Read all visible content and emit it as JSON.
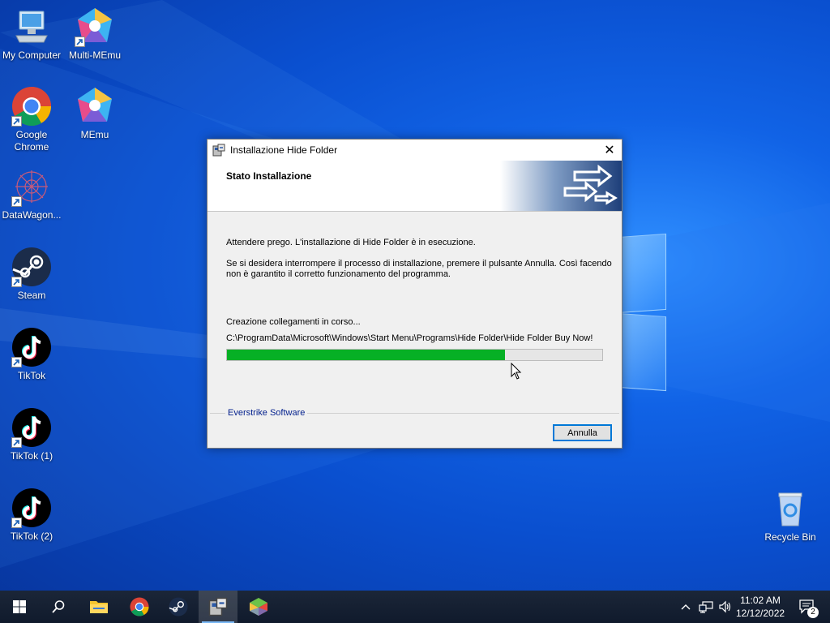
{
  "desktop": {
    "icons": [
      {
        "label": "My Computer",
        "icon": "computer-icon"
      },
      {
        "label": "Multi-MEmu",
        "icon": "memu-multi-icon"
      },
      {
        "label": "Google Chrome",
        "icon": "chrome-icon"
      },
      {
        "label": "MEmu",
        "icon": "memu-icon"
      },
      {
        "label": "DataWagon...",
        "icon": "datawagon-icon"
      },
      {
        "label": "Steam",
        "icon": "steam-icon"
      },
      {
        "label": "TikTok",
        "icon": "tiktok-icon"
      },
      {
        "label": "TikTok (1)",
        "icon": "tiktok-icon"
      },
      {
        "label": "TikTok (2)",
        "icon": "tiktok-icon"
      },
      {
        "label": "Recycle Bin",
        "icon": "recycle-bin-icon"
      }
    ]
  },
  "dialog": {
    "title": "Installazione Hide Folder",
    "header_title": "Stato Installazione",
    "message1": "Attendere prego. L'installazione di Hide Folder è in esecuzione.",
    "message2_line1": "Se si desidera interrompere il processo di installazione, premere il pulsante Annulla. Così facendo",
    "message2_line2": "non è garantito il corretto funzionamento del programma.",
    "status": "Creazione collegamenti in corso...",
    "current_path": "C:\\ProgramData\\Microsoft\\Windows\\Start Menu\\Programs\\Hide Folder\\Hide Folder Buy Now!",
    "progress_percent": 74,
    "brand": "Everstrike Software",
    "cancel_label": "Annulla",
    "close_glyph": "✕"
  },
  "taskbar": {
    "items": [
      "start-icon",
      "search-icon",
      "file-explorer-icon",
      "chrome-icon",
      "steam-icon",
      "installer-icon",
      "bluestacks-icon"
    ],
    "active_item": "installer-icon",
    "time": "11:02 AM",
    "date": "12/12/2022",
    "notification_count": "2"
  },
  "colors": {
    "progress_fill": "#06b025",
    "desktop_bg": "#0a4fcf",
    "brand_text": "#001e8c"
  }
}
